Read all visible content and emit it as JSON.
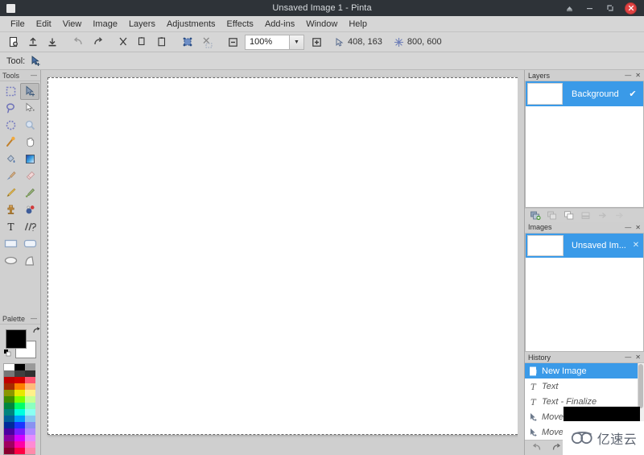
{
  "window": {
    "title": "Unsaved Image 1 - Pinta",
    "app_icon": "app-window-icon",
    "buttons": {
      "shade": "▲",
      "minimize": "—",
      "maximize": "❐",
      "close": "✕"
    }
  },
  "menubar": {
    "items": [
      {
        "label": "File"
      },
      {
        "label": "Edit"
      },
      {
        "label": "View"
      },
      {
        "label": "Image"
      },
      {
        "label": "Layers"
      },
      {
        "label": "Adjustments"
      },
      {
        "label": "Effects"
      },
      {
        "label": "Add-ins"
      },
      {
        "label": "Window"
      },
      {
        "label": "Help"
      }
    ]
  },
  "toolbar": {
    "buttons": [
      {
        "name": "new-image-icon",
        "tip": "New"
      },
      {
        "name": "open-image-icon",
        "tip": "Open"
      },
      {
        "name": "save-image-icon",
        "tip": "Save"
      },
      {
        "name": "undo-icon",
        "tip": "Undo"
      },
      {
        "name": "redo-icon",
        "tip": "Redo"
      },
      {
        "name": "cut-icon",
        "tip": "Cut"
      },
      {
        "name": "copy-icon",
        "tip": "Copy"
      },
      {
        "name": "paste-icon",
        "tip": "Paste"
      },
      {
        "name": "crop-to-selection-icon",
        "tip": "Crop to Selection"
      },
      {
        "name": "deselect-all-icon",
        "tip": "Deselect All"
      },
      {
        "name": "zoom-out-icon",
        "tip": "Zoom Out"
      }
    ],
    "zoom": {
      "value": "100%",
      "arrow": "▼"
    },
    "zoom_in_icon": "zoom-in-icon",
    "cursor_position": "408, 163",
    "image_size": "800, 600",
    "cursor_icon": "cursor-position-icon",
    "size_icon": "image-size-icon"
  },
  "tool_options": {
    "label": "Tool:",
    "current_tool": "move-selected-icon"
  },
  "tools_panel": {
    "title": "Tools",
    "collapse": "—",
    "items": [
      {
        "name": "rectangle-select-tool",
        "label": "Rectangle Select"
      },
      {
        "name": "move-selected-tool",
        "label": "Move Selected",
        "active": true
      },
      {
        "name": "lasso-select-tool",
        "label": "Lasso Select"
      },
      {
        "name": "move-selection-tool",
        "label": "Move Selection"
      },
      {
        "name": "ellipse-select-tool",
        "label": "Ellipse Select"
      },
      {
        "name": "zoom-tool",
        "label": "Zoom"
      },
      {
        "name": "magic-wand-tool",
        "label": "Magic Wand Select"
      },
      {
        "name": "pan-tool",
        "label": "Pan"
      },
      {
        "name": "paint-bucket-tool",
        "label": "Paint Bucket"
      },
      {
        "name": "gradient-tool",
        "label": "Gradient"
      },
      {
        "name": "paintbrush-tool",
        "label": "Paintbrush"
      },
      {
        "name": "eraser-tool",
        "label": "Eraser"
      },
      {
        "name": "pencil-tool",
        "label": "Pencil"
      },
      {
        "name": "color-picker-tool",
        "label": "Color Picker"
      },
      {
        "name": "clone-stamp-tool",
        "label": "Clone Stamp"
      },
      {
        "name": "recolor-tool",
        "label": "Recolor"
      },
      {
        "name": "text-tool",
        "label": "Text"
      },
      {
        "name": "line-curve-tool",
        "label": "Line/Curve"
      },
      {
        "name": "rectangle-shape-tool",
        "label": "Rectangle"
      },
      {
        "name": "rounded-rectangle-tool",
        "label": "Rounded Rectangle"
      },
      {
        "name": "ellipse-shape-tool",
        "label": "Ellipse"
      },
      {
        "name": "freeform-shape-tool",
        "label": "Freeform Shape"
      }
    ]
  },
  "palette_panel": {
    "title": "Palette",
    "collapse": "—",
    "primary_color": "#000000",
    "secondary_color": "#ffffff",
    "swap_icon": "swap-colors-icon",
    "reset_icon": "reset-colors-icon",
    "swatches": [
      [
        "#ffffff",
        "#000000",
        "#9a9a9a"
      ],
      [
        "#767676",
        "#3f3f3f",
        "#303030"
      ],
      [
        "#c00000",
        "#d40000",
        "#ff5772"
      ],
      [
        "#a52a00",
        "#ff8000",
        "#ffbb7a"
      ],
      [
        "#8a9600",
        "#e8e800",
        "#fff089"
      ],
      [
        "#3e8c00",
        "#7bff00",
        "#c6ff93"
      ],
      [
        "#00863e",
        "#00ff6a",
        "#8bffc0"
      ],
      [
        "#00847e",
        "#00ffe0",
        "#8bfff2"
      ],
      [
        "#00609a",
        "#00a0ff",
        "#8ac7f0"
      ],
      [
        "#002a9a",
        "#1b35ff",
        "#8a92f0"
      ],
      [
        "#4b00a0",
        "#7b1bff",
        "#b08aff"
      ],
      [
        "#8a00a0",
        "#d400ff",
        "#e58aff"
      ],
      [
        "#a00060",
        "#ff00a6",
        "#ff8ad4"
      ],
      [
        "#8a0030",
        "#ff0044",
        "#ff8aaa"
      ]
    ]
  },
  "canvas": {
    "width_label": "800",
    "height_label": "600",
    "background": "#ffffff"
  },
  "layers_panel": {
    "title": "Layers",
    "minimize": "—",
    "close": "✕",
    "rows": [
      {
        "name": "Background",
        "visible": true,
        "check": "✔",
        "selected": true
      }
    ],
    "toolbar": [
      {
        "name": "add-layer-icon"
      },
      {
        "name": "delete-layer-icon"
      },
      {
        "name": "duplicate-layer-icon"
      },
      {
        "name": "merge-layer-down-icon"
      },
      {
        "name": "move-layer-up-icon"
      },
      {
        "name": "move-layer-down-icon"
      }
    ]
  },
  "images_panel": {
    "title": "Images",
    "minimize": "—",
    "close": "✕",
    "rows": [
      {
        "name": "Unsaved Im...",
        "close": "✕",
        "selected": true
      }
    ]
  },
  "history_panel": {
    "title": "History",
    "minimize": "—",
    "close": "✕",
    "rows": [
      {
        "label": "New Image",
        "icon": "new-image-icon",
        "selected": true
      },
      {
        "label": "Text",
        "icon": "text-icon",
        "selected": false
      },
      {
        "label": "Text - Finalize",
        "icon": "text-icon",
        "selected": false
      },
      {
        "label": "Move S",
        "icon": "move-selected-icon",
        "selected": false
      },
      {
        "label": "Move ",
        "icon": "move-selected-icon",
        "selected": false
      }
    ],
    "toolbar": [
      {
        "name": "history-undo-icon",
        "glyph": "↺"
      },
      {
        "name": "history-redo-icon",
        "glyph": "↻"
      }
    ]
  },
  "watermark": {
    "text": "亿速云",
    "logo": "cloud-logo-icon"
  }
}
